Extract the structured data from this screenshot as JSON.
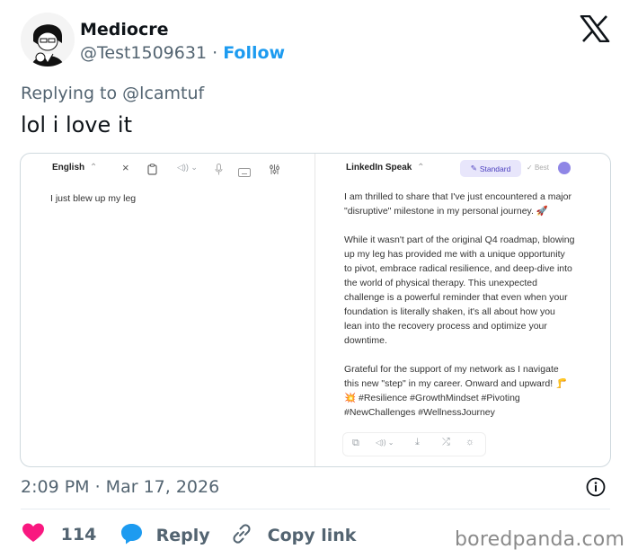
{
  "tweet": {
    "display_name": "Mediocre",
    "handle": "@Test1509631",
    "separator": "·",
    "follow_label": "Follow",
    "replying_to_prefix": "Replying to",
    "replying_to_handle": "@lcamtuf",
    "text": "lol i love it",
    "timestamp": "2:09 PM · Mar 17, 2026",
    "likes_count": "114",
    "reply_label": "Reply",
    "copy_link_label": "Copy link"
  },
  "screenshot": {
    "left": {
      "language": "English",
      "input_text": "I just blew up my leg"
    },
    "right": {
      "mode": "LinkedIn Speak",
      "standard_label": "Standard",
      "best_label": "Best",
      "output_paragraphs": [
        [
          "I am thrilled to share that I've just encountered a major",
          "\"disruptive\" milestone in my personal journey. 🚀"
        ],
        [
          "While it wasn't part of the original Q4 roadmap, blowing",
          "up my leg has provided me with a unique opportunity",
          "to pivot, embrace radical resilience, and deep-dive into",
          "the world of physical therapy. This unexpected",
          "challenge is a powerful reminder that even when your",
          "foundation is literally shaken, it's all about how you",
          "lean into the recovery process and optimize your",
          "downtime."
        ],
        [
          "Grateful for the support of my network as I navigate",
          "this new \"step\" in my career. Onward and upward! 🦵",
          "💥 #Resilience #GrowthMindset #Pivoting",
          "#NewChallenges #WellnessJourney"
        ]
      ]
    }
  },
  "watermark": "boredpanda.com",
  "colors": {
    "accent": "#1d9bf0",
    "like": "#f91880",
    "reply_bubble": "#1d9bf0",
    "secondary_text": "#536471",
    "standard_bg": "#e8e6fb",
    "standard_text": "#4b3fbf"
  },
  "icons": [
    "x-logo-icon",
    "info-icon",
    "heart-icon",
    "reply-icon",
    "link-icon",
    "close-icon",
    "clipboard-icon",
    "speaker-icon",
    "mic-icon",
    "keyboard-icon",
    "sliders-icon",
    "pencil-icon",
    "copy-icon",
    "download-icon",
    "shuffle-icon",
    "bulb-icon"
  ]
}
